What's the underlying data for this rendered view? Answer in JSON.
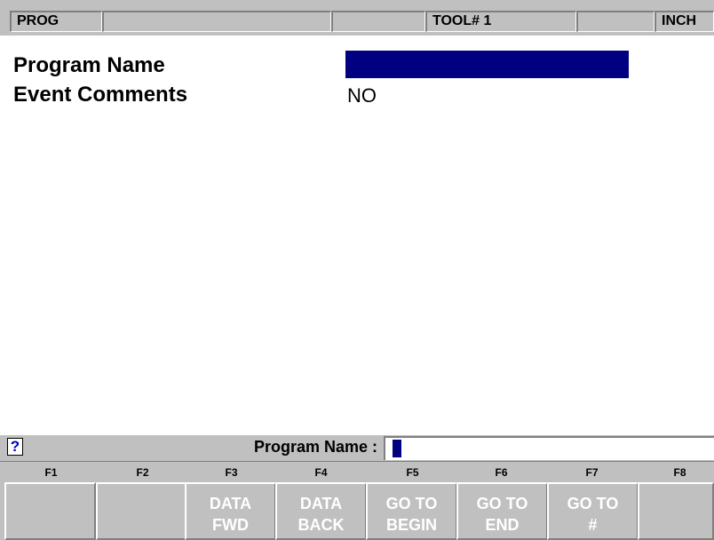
{
  "status_bar": {
    "mode": "PROG",
    "field_2": "",
    "field_3": "",
    "tool": "TOOL# 1",
    "field_5": "",
    "units": "INCH"
  },
  "main": {
    "program_name_label": "Program Name",
    "program_name_value": "",
    "event_comments_label": "Event Comments",
    "event_comments_value": "NO"
  },
  "prompt": {
    "help_glyph": "?",
    "label": "Program Name :",
    "value": ""
  },
  "function_keys": [
    {
      "key": "F1",
      "line1": "",
      "line2": ""
    },
    {
      "key": "F2",
      "line1": "",
      "line2": ""
    },
    {
      "key": "F3",
      "line1": "DATA",
      "line2": "FWD"
    },
    {
      "key": "F4",
      "line1": "DATA",
      "line2": "BACK"
    },
    {
      "key": "F5",
      "line1": "GO TO",
      "line2": "BEGIN"
    },
    {
      "key": "F6",
      "line1": "GO TO",
      "line2": "END"
    },
    {
      "key": "F7",
      "line1": "GO TO",
      "line2": "#"
    },
    {
      "key": "F8",
      "line1": "",
      "line2": ""
    }
  ],
  "colors": {
    "panel_gray": "#c0c0c0",
    "highlight_navy": "#000080",
    "help_blue": "#0000c0"
  }
}
